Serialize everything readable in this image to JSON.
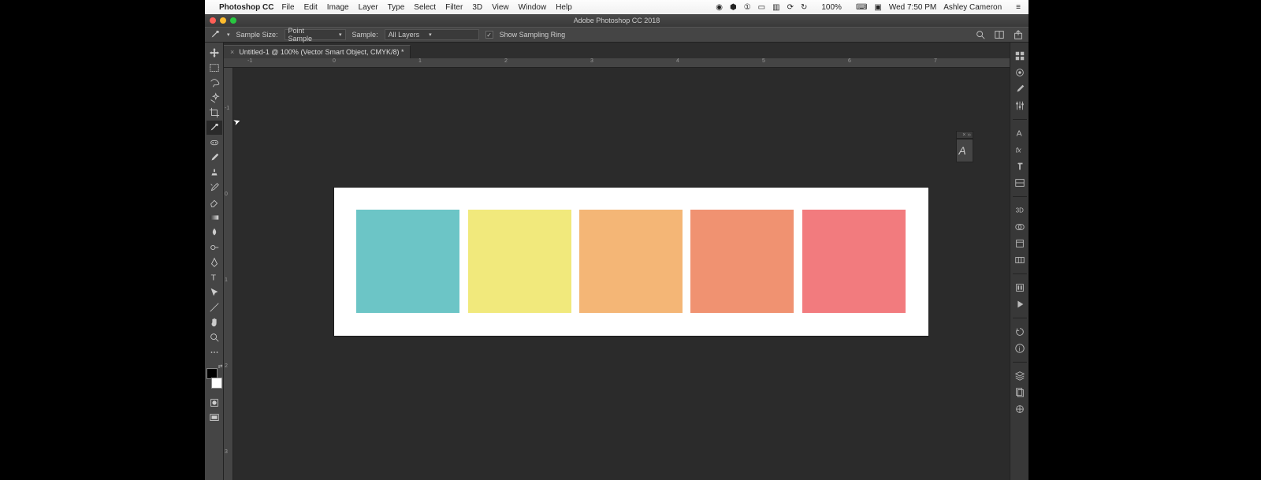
{
  "menubar": {
    "app_name": "Photoshop CC",
    "items": [
      "File",
      "Edit",
      "Image",
      "Layer",
      "Type",
      "Select",
      "Filter",
      "3D",
      "View",
      "Window",
      "Help"
    ],
    "right": {
      "battery": "100%",
      "clock": "Wed 7:50 PM",
      "user": "Ashley Cameron"
    }
  },
  "window": {
    "title": "Adobe Photoshop CC 2018"
  },
  "options_bar": {
    "sample_size_label": "Sample Size:",
    "sample_size_value": "Point Sample",
    "sample_label": "Sample:",
    "sample_value": "All Layers",
    "show_sampling_ring_label": "Show Sampling Ring",
    "show_sampling_ring_checked": true
  },
  "document": {
    "tab_label": "Untitled-1 @ 100% (Vector Smart Object, CMYK/8) *",
    "ruler_h": [
      "-1",
      "0",
      "1",
      "2",
      "3",
      "4",
      "5",
      "6",
      "7"
    ],
    "ruler_v": [
      "-1",
      "0",
      "1",
      "2",
      "3"
    ],
    "canvas_bg": "#ffffff",
    "swatches": [
      {
        "color": "#6cc5c6",
        "name": "teal"
      },
      {
        "color": "#f1e97c",
        "name": "light-yellow"
      },
      {
        "color": "#f4b676",
        "name": "light-orange"
      },
      {
        "color": "#f09271",
        "name": "coral"
      },
      {
        "color": "#f27b7e",
        "name": "salmon-pink"
      }
    ]
  },
  "toolbar": {
    "tools": [
      {
        "id": "move-tool"
      },
      {
        "id": "rectangular-marquee-tool"
      },
      {
        "id": "lasso-tool"
      },
      {
        "id": "magic-wand-tool"
      },
      {
        "id": "crop-tool"
      },
      {
        "id": "eyedropper-tool",
        "selected": true
      },
      {
        "id": "spot-healing-brush-tool"
      },
      {
        "id": "brush-tool"
      },
      {
        "id": "clone-stamp-tool"
      },
      {
        "id": "history-brush-tool"
      },
      {
        "id": "eraser-tool"
      },
      {
        "id": "gradient-tool"
      },
      {
        "id": "blur-tool"
      },
      {
        "id": "dodge-tool"
      },
      {
        "id": "pen-tool"
      },
      {
        "id": "type-tool"
      },
      {
        "id": "path-selection-tool"
      },
      {
        "id": "rectangle-tool"
      },
      {
        "id": "hand-tool"
      },
      {
        "id": "zoom-tool"
      },
      {
        "id": "edit-toolbar"
      }
    ],
    "foreground": "#000000",
    "background": "#ffffff",
    "extra": [
      {
        "id": "quick-mask"
      },
      {
        "id": "screen-mode"
      }
    ]
  },
  "dock_right": {
    "groups": [
      [
        "libraries-icon",
        "color-icon",
        "brush-settings-icon",
        "adjustments-icon"
      ],
      [
        "character-icon",
        "styles-icon",
        "paragraph-icon",
        "glyphs-icon"
      ],
      [
        "3d-panel-icon",
        "channels-icon",
        "properties-icon",
        "paths-icon"
      ],
      [
        "actions-icon",
        "play-icon"
      ],
      [
        "history-icon",
        "info-icon"
      ],
      [
        "layers-icon",
        "layer-comps-icon",
        "swatches-panel-icon"
      ]
    ]
  }
}
